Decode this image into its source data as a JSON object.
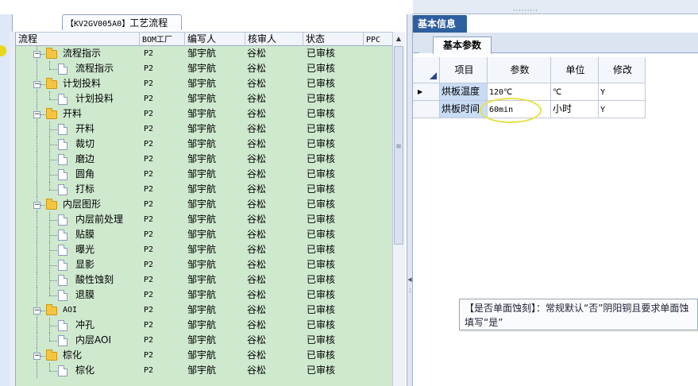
{
  "left_panel": {
    "title": {
      "code": "【KV2GV005A0】",
      "text": "工艺流程"
    },
    "columns": [
      {
        "label": "流程"
      },
      {
        "label": "BOM工厂"
      },
      {
        "label": "编写人"
      },
      {
        "label": "核审人"
      },
      {
        "label": "状态"
      },
      {
        "label": "PPC"
      }
    ],
    "rows": [
      {
        "name": "流程指示",
        "type": "folder",
        "level": 1,
        "bom": "P2",
        "author": "邹宇航",
        "reviewer": "谷松",
        "status": "已审核"
      },
      {
        "name": "流程指示",
        "type": "doc",
        "level": 2,
        "bom": "P2",
        "author": "邹宇航",
        "reviewer": "谷松",
        "status": "已审核"
      },
      {
        "name": "计划投料",
        "type": "folder",
        "level": 1,
        "bom": "P2",
        "author": "邹宇航",
        "reviewer": "谷松",
        "status": "已审核"
      },
      {
        "name": "计划投料",
        "type": "doc",
        "level": 2,
        "bom": "P2",
        "author": "邹宇航",
        "reviewer": "谷松",
        "status": "已审核"
      },
      {
        "name": "开料",
        "type": "folder",
        "level": 1,
        "bom": "P2",
        "author": "邹宇航",
        "reviewer": "谷松",
        "status": "已审核"
      },
      {
        "name": "开料",
        "type": "doc",
        "level": 2,
        "bom": "P2",
        "author": "邹宇航",
        "reviewer": "谷松",
        "status": "已审核"
      },
      {
        "name": "裁切",
        "type": "doc",
        "level": 2,
        "bom": "P2",
        "author": "邹宇航",
        "reviewer": "谷松",
        "status": "已审核"
      },
      {
        "name": "磨边",
        "type": "doc",
        "level": 2,
        "bom": "P2",
        "author": "邹宇航",
        "reviewer": "谷松",
        "status": "已审核"
      },
      {
        "name": "圆角",
        "type": "doc",
        "level": 2,
        "bom": "P2",
        "author": "邹宇航",
        "reviewer": "谷松",
        "status": "已审核"
      },
      {
        "name": "打标",
        "type": "doc",
        "level": 2,
        "bom": "P2",
        "author": "邹宇航",
        "reviewer": "谷松",
        "status": "已审核"
      },
      {
        "name": "内层图形",
        "type": "folder",
        "level": 1,
        "bom": "P2",
        "author": "邹宇航",
        "reviewer": "谷松",
        "status": "已审核"
      },
      {
        "name": "内层前处理",
        "type": "doc",
        "level": 2,
        "bom": "P2",
        "author": "邹宇航",
        "reviewer": "谷松",
        "status": "已审核"
      },
      {
        "name": "贴膜",
        "type": "doc",
        "level": 2,
        "bom": "P2",
        "author": "邹宇航",
        "reviewer": "谷松",
        "status": "已审核"
      },
      {
        "name": "曝光",
        "type": "doc",
        "level": 2,
        "bom": "P2",
        "author": "邹宇航",
        "reviewer": "谷松",
        "status": "已审核"
      },
      {
        "name": "显影",
        "type": "doc",
        "level": 2,
        "bom": "P2",
        "author": "邹宇航",
        "reviewer": "谷松",
        "status": "已审核"
      },
      {
        "name": "酸性蚀刻",
        "type": "doc",
        "level": 2,
        "bom": "P2",
        "author": "邹宇航",
        "reviewer": "谷松",
        "status": "已审核"
      },
      {
        "name": "退膜",
        "type": "doc",
        "level": 2,
        "bom": "P2",
        "author": "邹宇航",
        "reviewer": "谷松",
        "status": "已审核"
      },
      {
        "name": "AOI",
        "type": "folder",
        "level": 1,
        "bom": "P2",
        "author": "邹宇航",
        "reviewer": "谷松",
        "status": "已审核"
      },
      {
        "name": "冲孔",
        "type": "doc",
        "level": 2,
        "bom": "P2",
        "author": "邹宇航",
        "reviewer": "谷松",
        "status": "已审核"
      },
      {
        "name": "内层AOI",
        "type": "doc",
        "level": 2,
        "bom": "P2",
        "author": "邹宇航",
        "reviewer": "谷松",
        "status": "已审核"
      },
      {
        "name": "棕化",
        "type": "folder",
        "level": 1,
        "bom": "P2",
        "author": "邹宇航",
        "reviewer": "谷松",
        "status": "已审核"
      },
      {
        "name": "棕化",
        "type": "doc",
        "level": 2,
        "bom": "P2",
        "author": "邹宇航",
        "reviewer": "谷松",
        "status": "已审核"
      }
    ]
  },
  "right_panel": {
    "tab_title": "基本信息",
    "sub_tab": "基本参数",
    "param_columns": [
      "项目",
      "参数",
      "单位",
      "修改"
    ],
    "params": [
      {
        "item": "烘板温度",
        "value": "120℃",
        "unit": "℃",
        "modify": "Y"
      },
      {
        "item": "烘板时间",
        "value": "60min",
        "unit": "小时",
        "modify": "Y"
      }
    ],
    "tooltip": {
      "line1": "【是否单面蚀刻】：常规默认“否”阴阳铜且要求单面蚀",
      "line2": "填写“是”"
    }
  },
  "colors": {
    "grid_green": "#cfe9cf",
    "tab_blue": "#2e5f9f",
    "highlight_yellow": "#e6e04a"
  }
}
